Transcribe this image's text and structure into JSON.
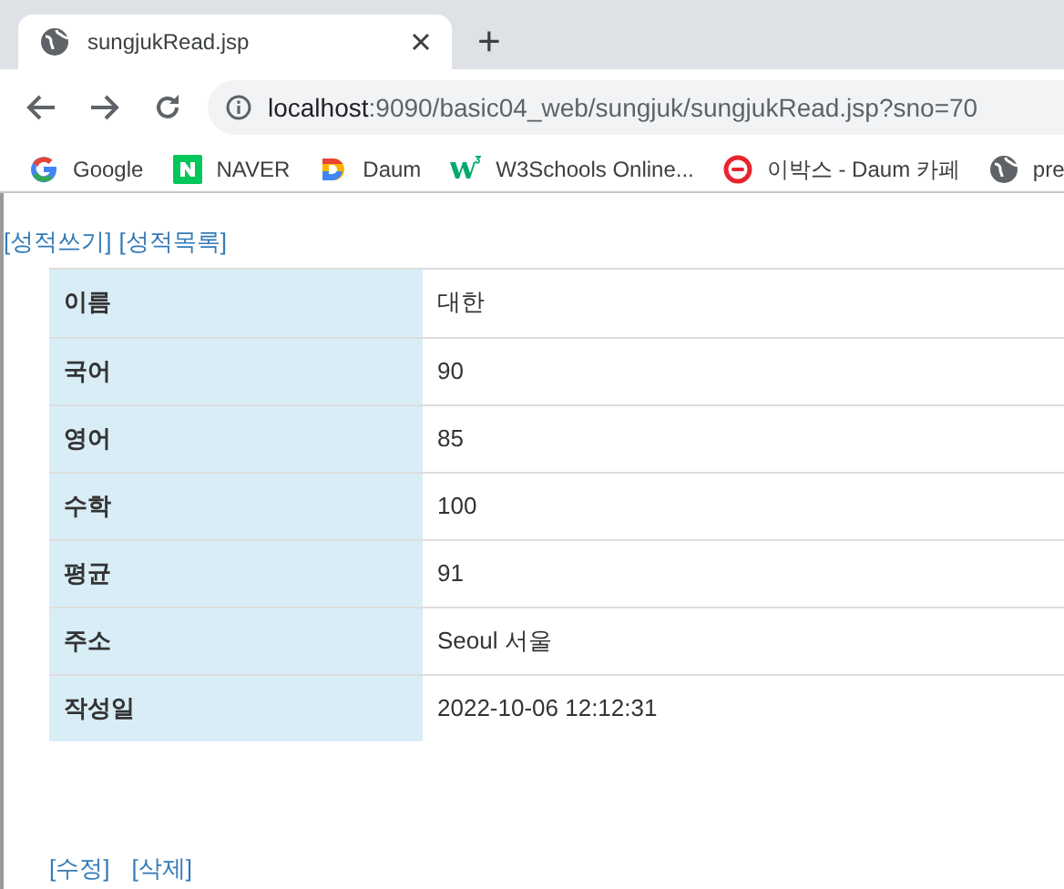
{
  "browser": {
    "tab": {
      "title": "sungjukRead.jsp"
    },
    "new_tab": "+",
    "address": {
      "host": "localhost",
      "path": ":9090/basic04_web/sungjuk/sungjukRead.jsp?sno=70"
    },
    "bookmarks": [
      {
        "kind": "google",
        "label": "Google"
      },
      {
        "kind": "naver",
        "label": "NAVER"
      },
      {
        "kind": "daum",
        "label": "Daum"
      },
      {
        "kind": "w3",
        "label": "W3Schools Online..."
      },
      {
        "kind": "cafe",
        "label": "이박스 - Daum 카페"
      },
      {
        "kind": "globe",
        "label": "pre"
      }
    ]
  },
  "top_links": [
    "[성적쓰기]",
    "[성적목록]"
  ],
  "table": {
    "rows": [
      {
        "label": "이름",
        "value": "대한"
      },
      {
        "label": "국어",
        "value": "90"
      },
      {
        "label": "영어",
        "value": "85"
      },
      {
        "label": "수학",
        "value": "100"
      },
      {
        "label": "평균",
        "value": "91"
      },
      {
        "label": "주소",
        "value": "Seoul 서울"
      },
      {
        "label": "작성일",
        "value": "2022-10-06 12:12:31"
      }
    ]
  },
  "bottom_links": [
    "[수정]",
    "[삭제]"
  ]
}
